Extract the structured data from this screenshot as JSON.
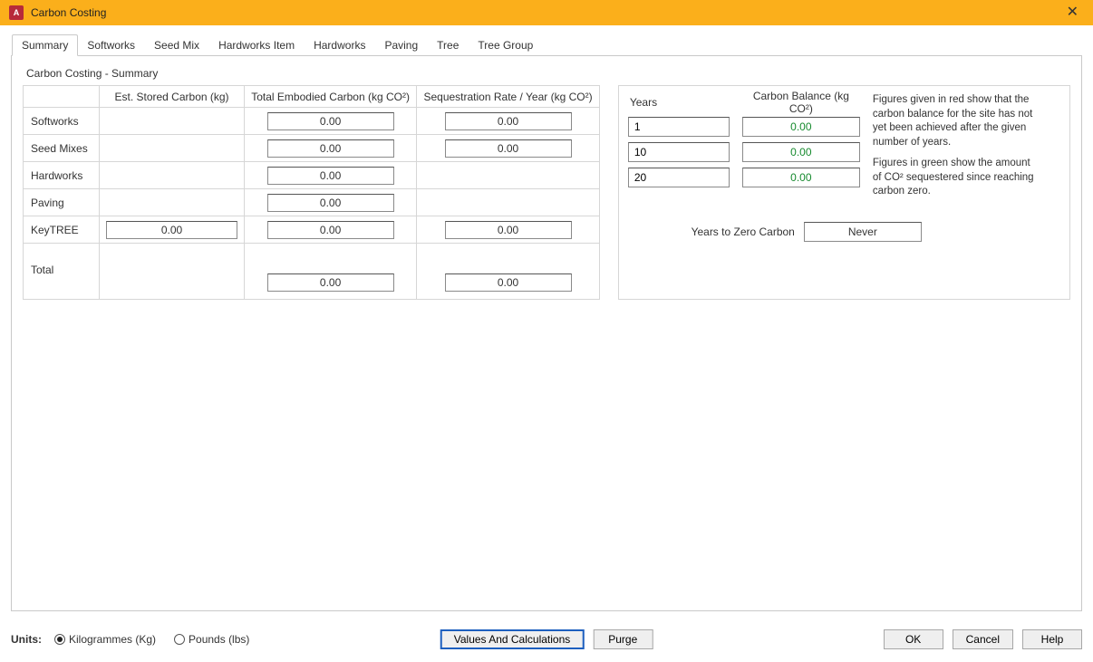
{
  "window": {
    "title": "Carbon Costing",
    "app_icon_letter": "A"
  },
  "tabs": [
    {
      "label": "Summary",
      "active": true
    },
    {
      "label": "Softworks",
      "active": false
    },
    {
      "label": "Seed Mix",
      "active": false
    },
    {
      "label": "Hardworks Item",
      "active": false
    },
    {
      "label": "Hardworks",
      "active": false
    },
    {
      "label": "Paving",
      "active": false
    },
    {
      "label": "Tree",
      "active": false
    },
    {
      "label": "Tree Group",
      "active": false
    }
  ],
  "summary": {
    "panel_title": "Carbon Costing - Summary",
    "col_headers": {
      "stored": "Est. Stored Carbon (kg)",
      "embodied": "Total Embodied Carbon (kg CO²)",
      "seq": "Sequestration Rate / Year (kg CO²)"
    },
    "rows": [
      {
        "label": "Softworks",
        "stored": "",
        "embodied": "0.00",
        "seq": "0.00"
      },
      {
        "label": "Seed Mixes",
        "stored": "",
        "embodied": "0.00",
        "seq": "0.00"
      },
      {
        "label": "Hardworks",
        "stored": "",
        "embodied": "0.00",
        "seq": ""
      },
      {
        "label": "Paving",
        "stored": "",
        "embodied": "0.00",
        "seq": ""
      },
      {
        "label": "KeyTREE",
        "stored": "0.00",
        "embodied": "0.00",
        "seq": "0.00"
      }
    ],
    "total": {
      "label": "Total",
      "stored": "",
      "embodied": "0.00",
      "seq": "0.00"
    }
  },
  "balance": {
    "years_header": "Years",
    "balance_header": "Carbon Balance (kg CO²)",
    "rows": [
      {
        "years": "1",
        "balance": "0.00"
      },
      {
        "years": "10",
        "balance": "0.00"
      },
      {
        "years": "20",
        "balance": "0.00"
      }
    ],
    "zero_label": "Years to Zero Carbon",
    "zero_value": "Never",
    "legend_red": "Figures given in red show that the carbon balance for the site has not yet been achieved after the given number of years.",
    "legend_green": "Figures in green show the amount of CO² sequestered since reaching carbon zero."
  },
  "footer": {
    "units_label": "Units:",
    "radio_kg": "Kilogrammes (Kg)",
    "radio_lbs": "Pounds (lbs)",
    "selected_unit": "kg",
    "btn_values": "Values And Calculations",
    "btn_purge": "Purge",
    "btn_ok": "OK",
    "btn_cancel": "Cancel",
    "btn_help": "Help"
  }
}
